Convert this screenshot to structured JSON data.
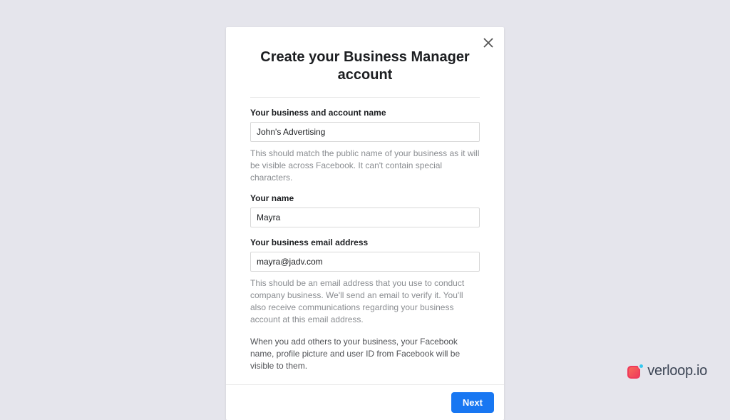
{
  "modal": {
    "title": "Create your Business Manager account",
    "businessName": {
      "label": "Your business and account name",
      "value": "John's Advertising",
      "help": "This should match the public name of your business as it will be visible across Facebook. It can't contain special characters."
    },
    "yourName": {
      "label": "Your name",
      "value": "Mayra"
    },
    "businessEmail": {
      "label": "Your business email address",
      "value": "mayra@jadv.com",
      "help": "This should be an email address that you use to conduct company business. We'll send an email to verify it. You'll also receive communications regarding your business account at this email address."
    },
    "disclosure": "When you add others to your business, your Facebook name, profile picture and user ID from Facebook will be visible to them.",
    "nextButton": "Next"
  },
  "brand": {
    "name": "verloop.io"
  }
}
